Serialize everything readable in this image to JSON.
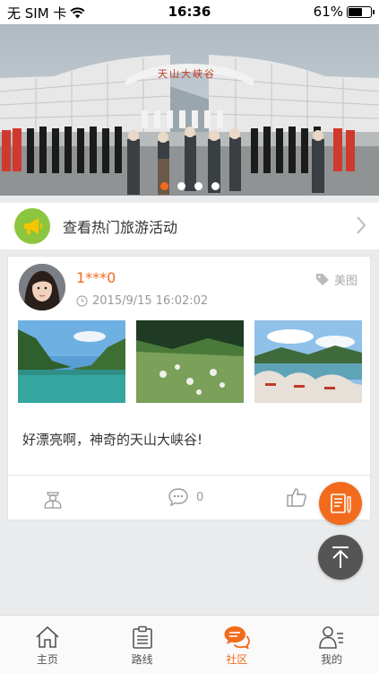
{
  "status_bar": {
    "carrier": "无 SIM 卡",
    "time": "16:36",
    "battery": "61%",
    "battery_level": 0.61
  },
  "banner": {
    "sign_text": "天山大峡谷",
    "slide_count": 4,
    "active_slide": 0
  },
  "hot_activities": {
    "label": "查看热门旅游活动",
    "icon": "megaphone-icon"
  },
  "post": {
    "username": "1***0",
    "timestamp": "2015/9/15 16:02:02",
    "tag": "美图",
    "text": "好漂亮啊，神奇的天山大峡谷!",
    "photos": [
      "lake-photo",
      "yurt-meadow-photo",
      "rock-lake-photo"
    ],
    "comment_count": "0"
  },
  "tabs": [
    {
      "label": "主页",
      "icon": "home-icon",
      "active": false
    },
    {
      "label": "路线",
      "icon": "clipboard-icon",
      "active": false
    },
    {
      "label": "社区",
      "icon": "chat-bubbles-icon",
      "active": true
    },
    {
      "label": "我的",
      "icon": "person-list-icon",
      "active": false
    }
  ],
  "colors": {
    "accent": "#f26b1d",
    "background": "#e9ebed",
    "hot_icon_bg": "#8cc63f",
    "fab_top_bg": "#555555"
  }
}
